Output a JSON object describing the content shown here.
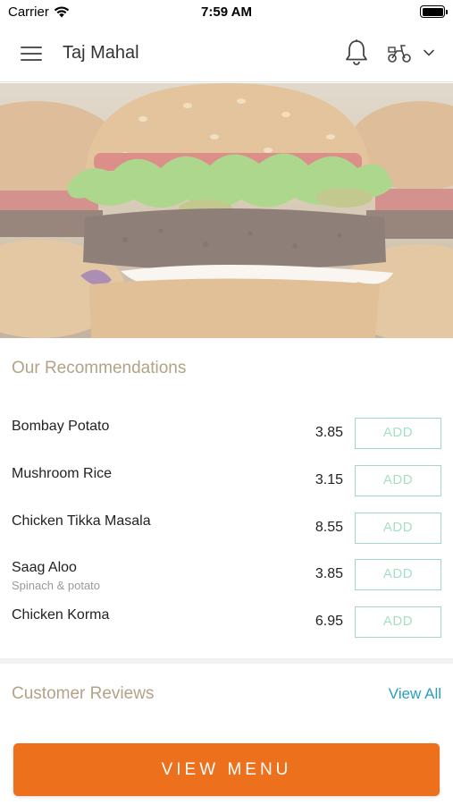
{
  "status_bar": {
    "carrier": "Carrier",
    "time": "7:59 AM",
    "icons": [
      "wifi-icon",
      "battery-icon"
    ]
  },
  "header": {
    "title": "Taj Mahal",
    "icons": [
      "menu-icon",
      "bell-icon",
      "scooter-icon",
      "chevron-down-icon"
    ]
  },
  "hero": {
    "image": "burger-photo"
  },
  "recommendations": {
    "title": "Our Recommendations",
    "items": [
      {
        "name": "Bombay Potato",
        "description": "",
        "price": "3.85",
        "button": "ADD"
      },
      {
        "name": "Mushroom Rice",
        "description": "",
        "price": "3.15",
        "button": "ADD"
      },
      {
        "name": "Chicken Tikka Masala",
        "description": "",
        "price": "8.55",
        "button": "ADD"
      },
      {
        "name": "Saag Aloo",
        "description": "Spinach & potato",
        "price": "3.85",
        "button": "ADD"
      },
      {
        "name": "Chicken Korma",
        "description": "",
        "price": "6.95",
        "button": "ADD"
      }
    ]
  },
  "reviews": {
    "title": "Customer Reviews",
    "view_all": "View All"
  },
  "footer": {
    "view_menu": "VIEW MENU"
  },
  "colors": {
    "accent": "#ed711d",
    "section_title": "#b3a286",
    "add_border": "#9fd9bf",
    "link": "#2a9fbe"
  }
}
